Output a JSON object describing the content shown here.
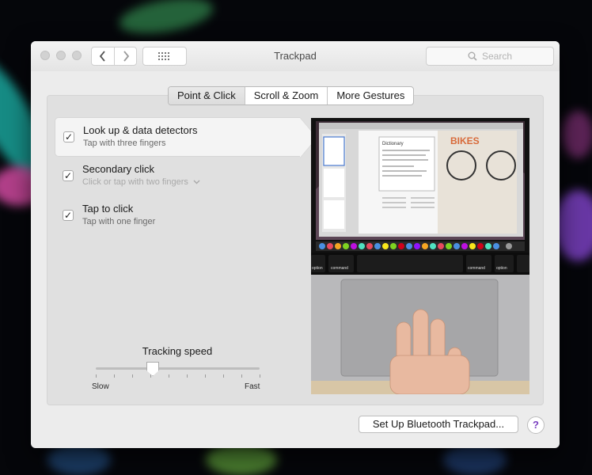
{
  "window": {
    "title": "Trackpad",
    "search_placeholder": "Search"
  },
  "tabs": [
    {
      "label": "Point & Click",
      "active": true
    },
    {
      "label": "Scroll & Zoom",
      "active": false
    },
    {
      "label": "More Gestures",
      "active": false
    }
  ],
  "options": [
    {
      "title": "Look up & data detectors",
      "subtitle": "Tap with three fingers",
      "checked": true,
      "selected": true
    },
    {
      "title": "Secondary click",
      "subtitle": "Click or tap with two fingers",
      "checked": true,
      "selected": false
    },
    {
      "title": "Tap to click",
      "subtitle": "Tap with one finger",
      "checked": true,
      "selected": false
    }
  ],
  "tracking": {
    "label": "Tracking speed",
    "min_label": "Slow",
    "max_label": "Fast",
    "value_fraction": 0.35
  },
  "preview": {
    "key_command_left": "command",
    "key_option_left": "option",
    "key_command_right": "command",
    "key_option_right": "option",
    "dictionary_heading": "Dictionary",
    "poster_text": "BIKES"
  },
  "footer": {
    "bluetooth_button": "Set Up Bluetooth Trackpad...",
    "help_label": "?"
  },
  "colors": {
    "accent_help": "#7a3fc0",
    "window_bg": "#ececec"
  }
}
